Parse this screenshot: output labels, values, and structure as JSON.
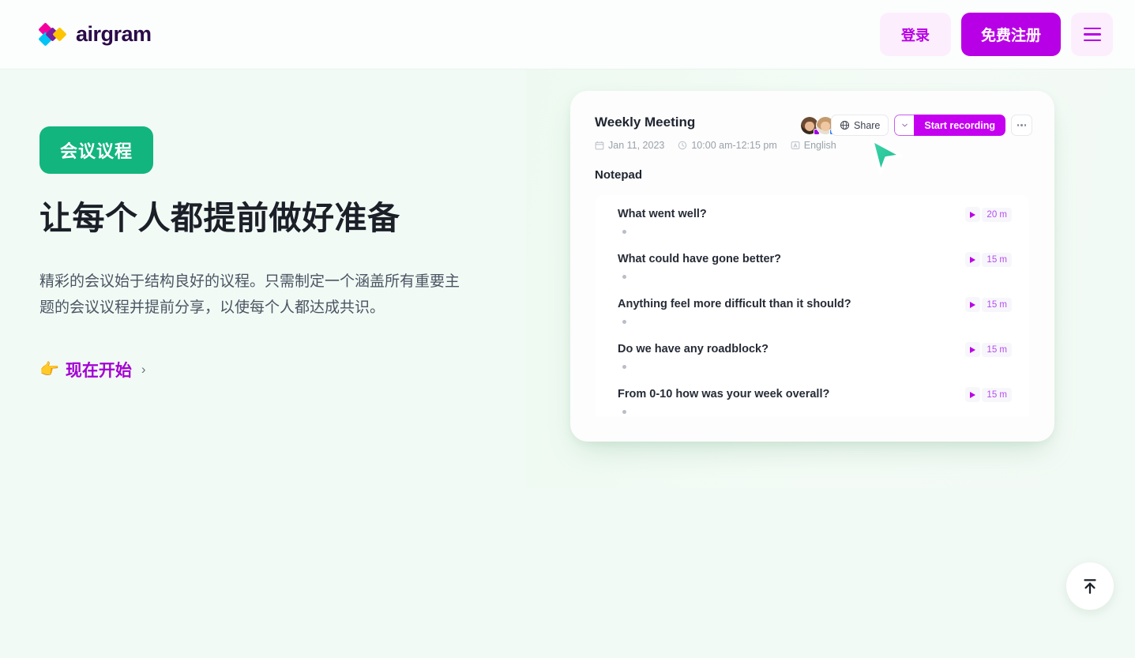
{
  "brand": {
    "name": "airgram",
    "logo_icon": "airgram-diamond-logo"
  },
  "nav": {
    "login_label": "登录",
    "signup_label": "免费注册",
    "menu_icon": "hamburger-menu-icon"
  },
  "hero": {
    "badge": "会议议程",
    "title": "让每个人都提前做好准备",
    "description": "精彩的会议始于结构良好的议程。只需制定一个涵盖所有重要主题的会议议程并提前分享，以使每个人都达成共识。",
    "cta_emoji": "👉",
    "cta_label": "现在开始",
    "cta_chevron": "›"
  },
  "card": {
    "title": "Weekly Meeting",
    "meta": {
      "date_icon": "calendar-icon",
      "date": "Jan 11, 2023",
      "time_icon": "clock-icon",
      "time": "10:00 am-12:15 pm",
      "language_icon": "language-icon",
      "language": "English"
    },
    "participants": [
      {
        "name": "participant-1",
        "status_color": "#a100e0"
      },
      {
        "name": "participant-2",
        "status_color": "#2d7ff9"
      },
      {
        "name": "participant-3",
        "status_color": "#10b981"
      }
    ],
    "actions": {
      "share_icon": "globe-icon",
      "share_label": "Share",
      "record_caret_icon": "chevron-down-icon",
      "record_label": "Start recording",
      "more_icon": "more-horizontal-icon"
    },
    "cursor_icon": "mouse-cursor-arrow",
    "notepad_label": "Notepad",
    "notepad_items": [
      {
        "title": "What went well?",
        "duration": "20 m",
        "play_icon": "play-icon"
      },
      {
        "title": "What could have gone better?",
        "duration": "15 m",
        "play_icon": "play-icon"
      },
      {
        "title": "Anything feel more difficult than it should?",
        "duration": "15 m",
        "play_icon": "play-icon"
      },
      {
        "title": "Do we have any roadblock?",
        "duration": "15 m",
        "play_icon": "play-icon"
      },
      {
        "title": "From 0-10 how was your week overall?",
        "duration": "15 m",
        "play_icon": "play-icon"
      }
    ]
  },
  "scroll_top": {
    "icon": "arrow-up-to-line-icon"
  },
  "colors": {
    "brand_purple": "#b800e6",
    "record_purple": "#c500f0",
    "badge_green": "#12b57e",
    "page_bg": "#f2faf5",
    "cta_purple": "#a400d4"
  }
}
